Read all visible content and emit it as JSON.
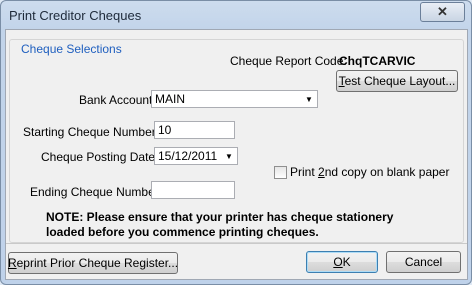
{
  "window": {
    "title": "Print Creditor Cheques",
    "close_glyph": "✕"
  },
  "group": {
    "legend": "Cheque Selections"
  },
  "report_code": {
    "label": "Cheque Report Code:",
    "value": "ChqTCARVIC"
  },
  "test_layout_button": {
    "pre": "",
    "mnemonic": "T",
    "post": "est Cheque Layout..."
  },
  "bank_account": {
    "label": "Bank Account:",
    "value": "MAIN"
  },
  "starting_cheque": {
    "label": "Starting Cheque Number:",
    "value": "10"
  },
  "posting_date": {
    "label": "Cheque Posting Date:",
    "value": "15/12/2011"
  },
  "print_second_copy": {
    "pre": "Print ",
    "mnemonic": "2",
    "post": "nd copy on blank paper",
    "checked": false
  },
  "ending_cheque": {
    "label": "Ending Cheque Number:",
    "value": ""
  },
  "note": {
    "line1": "NOTE: Please ensure that your printer has cheque stationery",
    "line2": "loaded before you commence printing cheques."
  },
  "reprint_button": {
    "pre": "",
    "mnemonic": "R",
    "post": "eprint Prior Cheque Register..."
  },
  "ok_button": {
    "pre": "",
    "mnemonic": "O",
    "post": "K"
  },
  "cancel_button": {
    "label": "Cancel"
  },
  "icons": {
    "dropdown": "dropdown-arrow-icon",
    "close": "close-icon"
  }
}
